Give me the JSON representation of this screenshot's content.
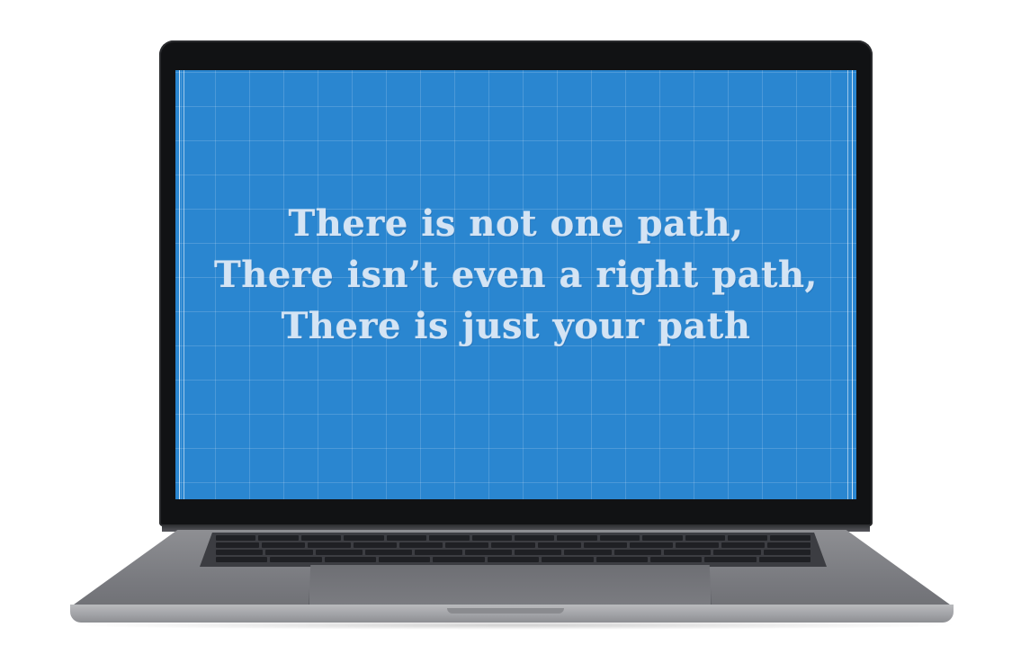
{
  "screen": {
    "background_color": "#2a86d0",
    "text_color": "#d4e4f4",
    "quote_lines": [
      "There is not one path,",
      "There isn’t even a right path,",
      "There is just your path"
    ]
  }
}
